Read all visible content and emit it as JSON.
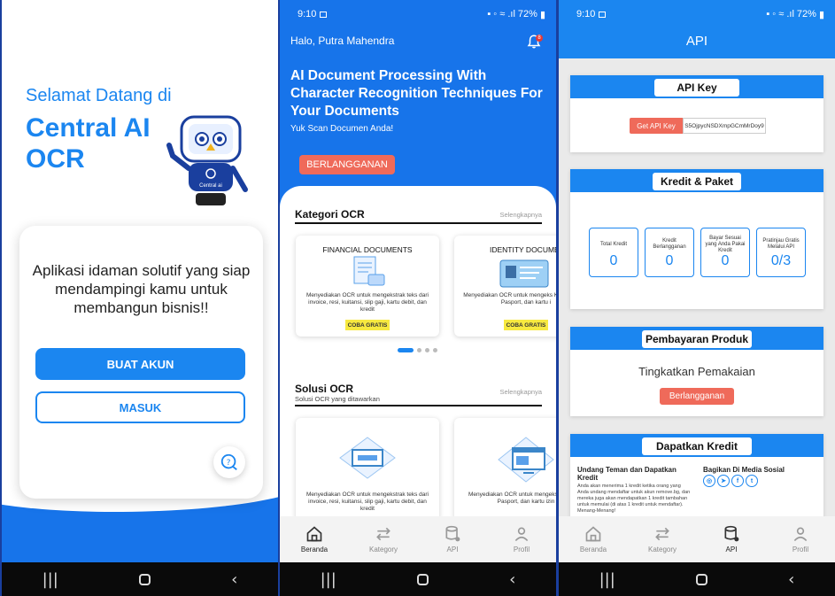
{
  "welcome": {
    "greeting": "Selamat Datang di",
    "app_name": "Central AI OCR",
    "robot_badge": "Central ai",
    "tagline": "Aplikasi idaman solutif yang siap mendampingi kamu untuk membangun bisnis!!",
    "create_account_label": "BUAT AKUN",
    "login_label": "MASUK"
  },
  "status": {
    "time": "9:10",
    "battery": "72%"
  },
  "home": {
    "hello": "Halo, Putra Mahendra",
    "notif_count": "8",
    "headline": "AI Document Processing With Character Recognition Techniques For Your Documents",
    "subhead": "Yuk Scan Documen Anda!",
    "subscribe_label": "BERLANGGANAN",
    "kategori_title": "Kategori OCR",
    "kategori_more": "Selengkapnya",
    "categories": [
      {
        "title": "FINANCIAL DOCUMENTS",
        "desc": "Menyediakan OCR untuk mengekstrak teks dari invoice, resi, kuitansi, slip gaji, kartu debit, dan kredit",
        "cta": "COBA GRATIS"
      },
      {
        "title": "IDENTITY DOCUMEN",
        "desc": "Menyediakan OCR untuk mengeks KTP, ID, SIM, Pasport, dan kartu i",
        "cta": "COBA GRATIS"
      }
    ],
    "solusi_title": "Solusi OCR",
    "solusi_sub": "Solusi OCR yang ditawarkan",
    "solusi_more": "Selengkapnya",
    "solutions": [
      {
        "desc": "Menyediakan OCR untuk mengekstrak teks dari invoice, resi, kuitansi, slip gaji, kartu debit, dan kredit"
      },
      {
        "desc": "Menyediakan OCR untuk mengekstr ID, SIM, Pasport, dan kartu izin"
      }
    ]
  },
  "tabs": {
    "beranda": "Beranda",
    "kategory": "Kategory",
    "api": "API",
    "profil": "Profil"
  },
  "api": {
    "title": "API",
    "apikey_label": "API Key",
    "get_key_label": "Get API Key",
    "key_value": "S5OjpycNSDXmpGCmMrDoy9",
    "kredit_label": "Kredit & Paket",
    "stats": [
      {
        "label": "Total Kredit",
        "value": "0"
      },
      {
        "label": "Kredit Berlangganan",
        "value": "0"
      },
      {
        "label": "Bayar Sesuai yang Anda Pakai Kredit",
        "value": "0"
      },
      {
        "label": "Pratinjau Gratis Melalui API",
        "value": "0/3"
      }
    ],
    "payment_label": "Pembayaran Produk",
    "upgrade_text": "Tingkatkan Pemakaian",
    "subscribe_label": "Berlangganan",
    "dapatkan_label": "Dapatkan Kredit",
    "invite_title": "Undang Teman dan Dapatkan Kredit",
    "invite_desc": "Anda akan menerima 1 kredit ketika orang yang Anda undang mendaftar untuk akun remove.bg, dan mereka juga akan mendapatkan 1 kredit tambahan untuk memulai (di atas 1 kredit untuk mendaftar). Menang-Menang!",
    "share_title": "Bagikan Di Media Sosial"
  },
  "colors": {
    "primary": "#1b86f0",
    "accent": "#ef6a5a",
    "cta_yellow": "#f7e940"
  }
}
